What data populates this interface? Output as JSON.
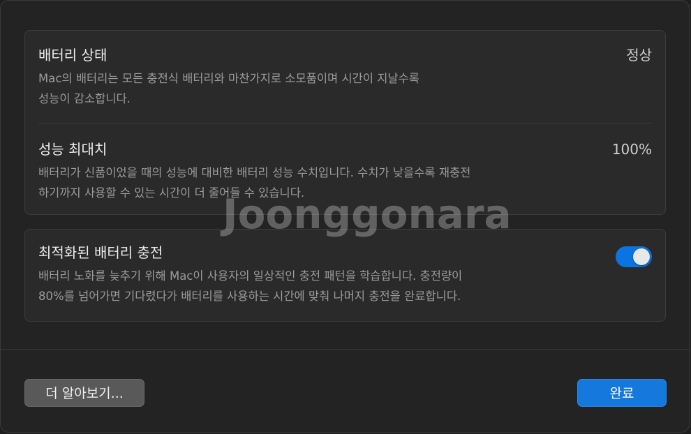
{
  "health": {
    "title": "배터리 상태",
    "value": "정상",
    "description": "Mac의 배터리는 모든 충전식 배터리와 마찬가지로 소모품이며 시간이 지날수록\n성능이 감소합니다."
  },
  "capacity": {
    "title": "성능 최대치",
    "value": "100%",
    "description": "배터리가 신품이었을 때의 성능에 대비한 배터리 성능 수치입니다. 수치가 낮을수록 재충전\n하기까지 사용할 수 있는 시간이 더 줄어들 수 있습니다."
  },
  "optimized_charging": {
    "title": "최적화된 배터리 충전",
    "enabled": true,
    "description": "배터리 노화를 늦추기 위해 Mac이 사용자의 일상적인 충전 패턴을 학습합니다. 충전량이\n80%를 넘어가면 기다렸다가 배터리를 사용하는 시간에 맞춰 나머지 충전을 완료합니다."
  },
  "watermark": "Joonggonara",
  "footer": {
    "learn_more_label": "더 알아보기...",
    "done_label": "완료"
  },
  "colors": {
    "accent": "#1478dc",
    "background": "#232323",
    "group_background": "#2a2a2a"
  }
}
